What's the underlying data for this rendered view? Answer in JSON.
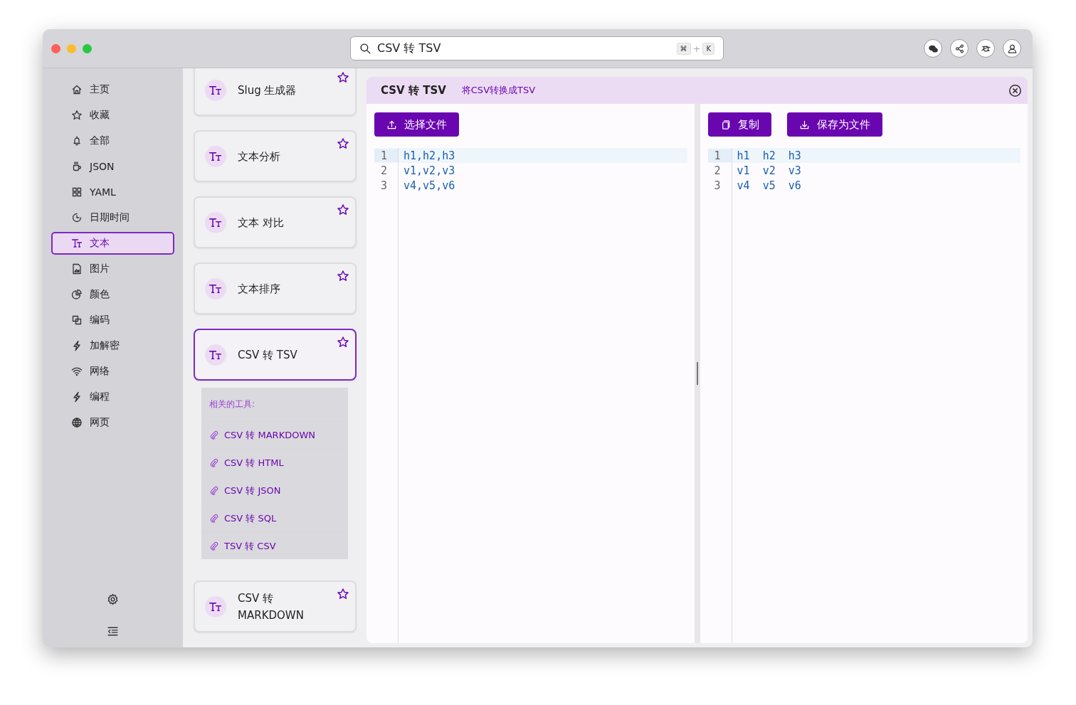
{
  "titlebar": {
    "search": {
      "value": "CSV 转 TSV",
      "keys": [
        "⌘",
        "+",
        "K"
      ]
    }
  },
  "sidebar": {
    "items": [
      {
        "label": "主页",
        "selected": false
      },
      {
        "label": "收藏",
        "selected": false
      },
      {
        "label": "全部",
        "selected": false
      },
      {
        "label": "JSON",
        "selected": false
      },
      {
        "label": "YAML",
        "selected": false
      },
      {
        "label": "日期时间",
        "selected": false
      },
      {
        "label": "文本",
        "selected": true
      },
      {
        "label": "图片",
        "selected": false
      },
      {
        "label": "颜色",
        "selected": false
      },
      {
        "label": "编码",
        "selected": false
      },
      {
        "label": "加解密",
        "selected": false
      },
      {
        "label": "网络",
        "selected": false
      },
      {
        "label": "编程",
        "selected": false
      },
      {
        "label": "网页",
        "selected": false
      }
    ]
  },
  "tool_list": {
    "tools": [
      {
        "title": "Slug 生成器",
        "selected": false
      },
      {
        "title": "文本分析",
        "selected": false
      },
      {
        "title": "文本 对比",
        "selected": false
      },
      {
        "title": "文本排序",
        "selected": false
      },
      {
        "title": "CSV 转 TSV",
        "selected": true
      },
      {
        "title": "CSV 转 MARKDOWN",
        "selected": false
      }
    ],
    "related": {
      "title": "相关的工具:",
      "links": [
        "CSV 转 MARKDOWN",
        "CSV 转 HTML",
        "CSV 转 JSON",
        "CSV 转 SQL",
        "TSV 转 CSV"
      ]
    }
  },
  "tool": {
    "title": "CSV 转 TSV",
    "subtitle": "将CSV转换成TSV",
    "input": {
      "buttons": [
        "选择文件"
      ],
      "lines": [
        {
          "number": "1",
          "text": "h1,h2,h3",
          "current": true
        },
        {
          "number": "2",
          "text": "v1,v2,v3",
          "current": false
        },
        {
          "number": "3",
          "text": "v4,v5,v6",
          "current": false
        }
      ]
    },
    "output": {
      "buttons": [
        "复制",
        "保存为文件"
      ],
      "lines": [
        {
          "number": "1",
          "text": "h1\th2\th3",
          "current": true
        },
        {
          "number": "2",
          "text": "v1\tv2\tv3",
          "current": false
        },
        {
          "number": "3",
          "text": "v4\tv5\tv6",
          "current": false
        }
      ]
    }
  }
}
